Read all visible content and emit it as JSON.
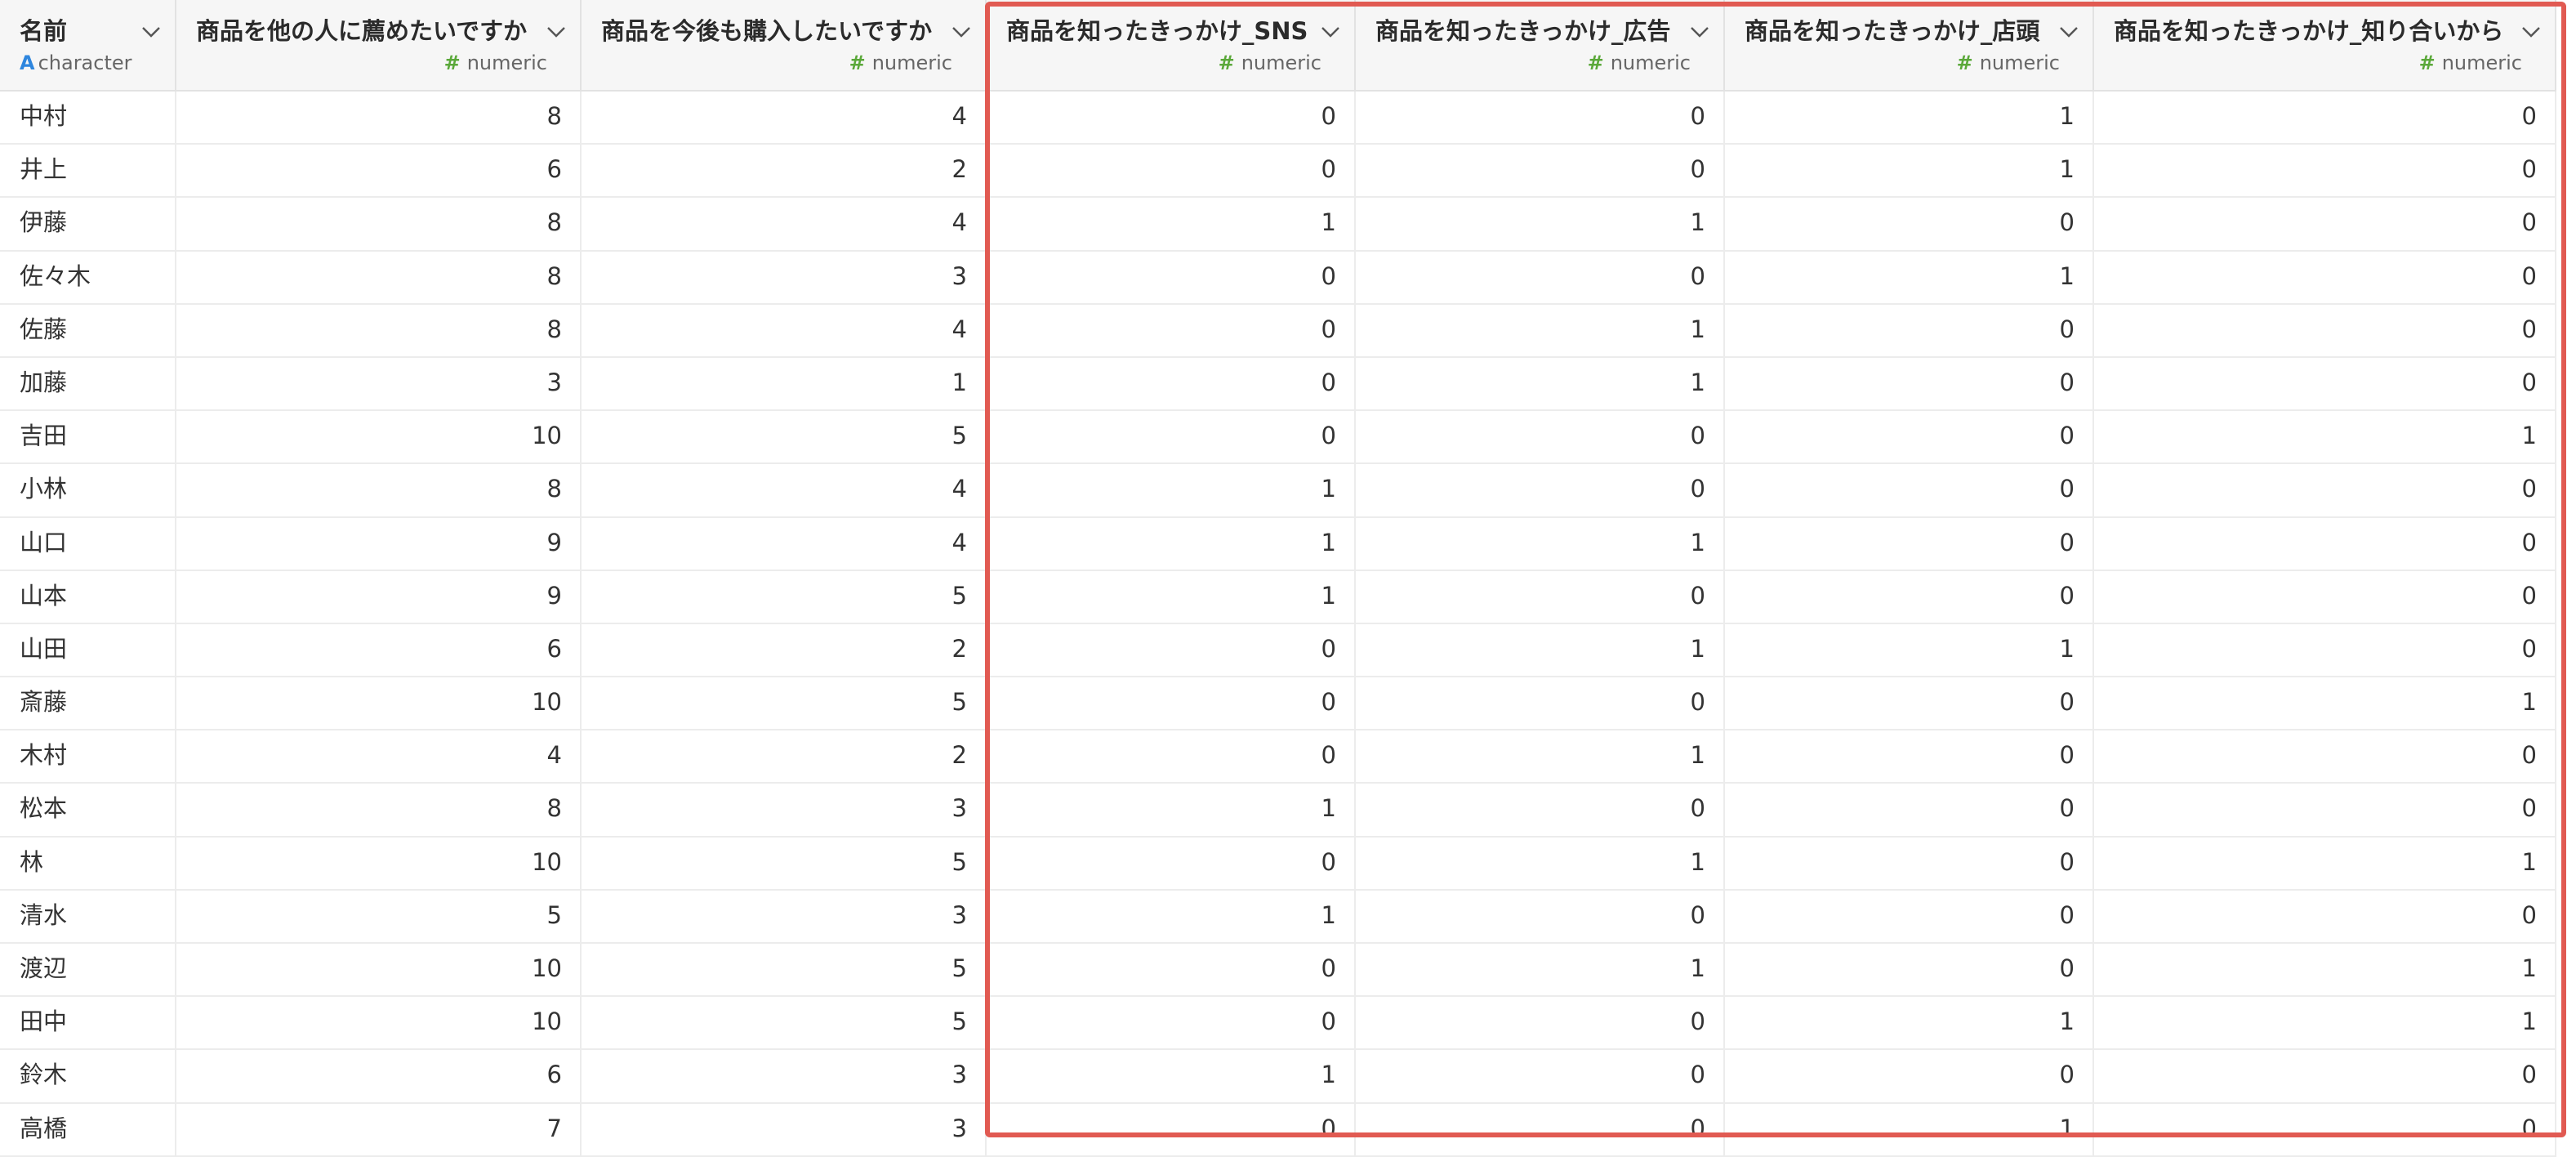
{
  "columns": [
    {
      "label": "名前",
      "type_label": "character",
      "type_icon": "A",
      "kind": "text"
    },
    {
      "label": "商品を他の人に薦めたいですか",
      "type_label": "numeric",
      "type_icon": "#",
      "kind": "num"
    },
    {
      "label": "商品を今後も購入したいですか",
      "type_label": "numeric",
      "type_icon": "#",
      "kind": "num"
    },
    {
      "label": "商品を知ったきっかけ_SNS",
      "type_label": "numeric",
      "type_icon": "#",
      "kind": "num"
    },
    {
      "label": "商品を知ったきっかけ_広告",
      "type_label": "numeric",
      "type_icon": "#",
      "kind": "num"
    },
    {
      "label": "商品を知ったきっかけ_店頭",
      "type_label": "numeric",
      "type_icon": "#",
      "kind": "num"
    },
    {
      "label": "商品を知ったきっかけ_知り合いから",
      "type_label": "numeric",
      "type_icon": "#",
      "kind": "num"
    }
  ],
  "rows": [
    [
      "中村",
      "8",
      "4",
      "0",
      "0",
      "1",
      "0"
    ],
    [
      "井上",
      "6",
      "2",
      "0",
      "0",
      "1",
      "0"
    ],
    [
      "伊藤",
      "8",
      "4",
      "1",
      "1",
      "0",
      "0"
    ],
    [
      "佐々木",
      "8",
      "3",
      "0",
      "0",
      "1",
      "0"
    ],
    [
      "佐藤",
      "8",
      "4",
      "0",
      "1",
      "0",
      "0"
    ],
    [
      "加藤",
      "3",
      "1",
      "0",
      "1",
      "0",
      "0"
    ],
    [
      "吉田",
      "10",
      "5",
      "0",
      "0",
      "0",
      "1"
    ],
    [
      "小林",
      "8",
      "4",
      "1",
      "0",
      "0",
      "0"
    ],
    [
      "山口",
      "9",
      "4",
      "1",
      "1",
      "0",
      "0"
    ],
    [
      "山本",
      "9",
      "5",
      "1",
      "0",
      "0",
      "0"
    ],
    [
      "山田",
      "6",
      "2",
      "0",
      "1",
      "1",
      "0"
    ],
    [
      "斎藤",
      "10",
      "5",
      "0",
      "0",
      "0",
      "1"
    ],
    [
      "木村",
      "4",
      "2",
      "0",
      "1",
      "0",
      "0"
    ],
    [
      "松本",
      "8",
      "3",
      "1",
      "0",
      "0",
      "0"
    ],
    [
      "林",
      "10",
      "5",
      "0",
      "1",
      "0",
      "1"
    ],
    [
      "清水",
      "5",
      "3",
      "1",
      "0",
      "0",
      "0"
    ],
    [
      "渡辺",
      "10",
      "5",
      "0",
      "1",
      "0",
      "1"
    ],
    [
      "田中",
      "10",
      "5",
      "0",
      "0",
      "1",
      "1"
    ],
    [
      "鈴木",
      "6",
      "3",
      "1",
      "0",
      "0",
      "0"
    ],
    [
      "高橋",
      "7",
      "3",
      "0",
      "0",
      "1",
      "0"
    ]
  ],
  "colors": {
    "highlight_border": "#e15a52",
    "numeric_icon": "#5aa839",
    "character_icon": "#2e86de"
  }
}
